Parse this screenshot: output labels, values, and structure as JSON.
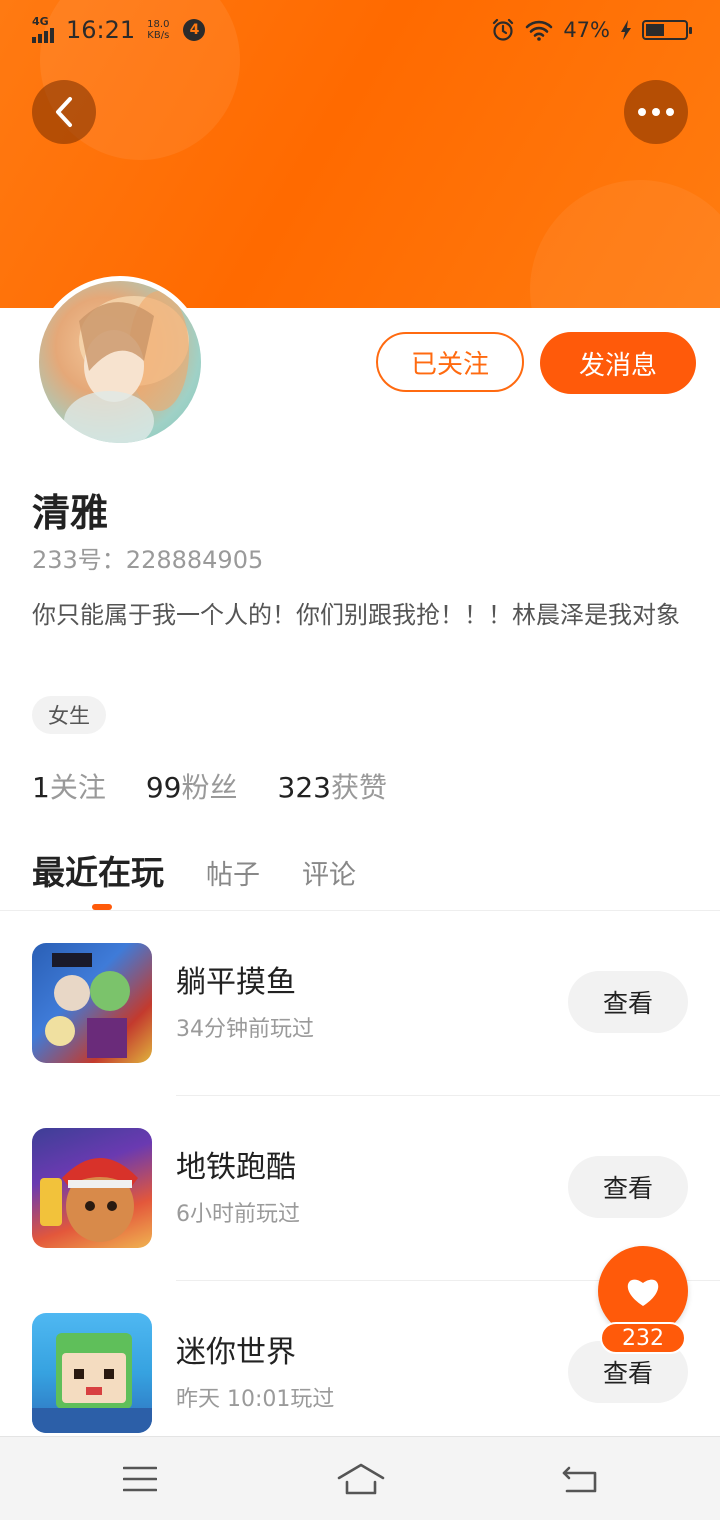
{
  "status_bar": {
    "network": "4G",
    "time": "16:21",
    "speed_value": "18.0",
    "speed_unit": "KB/s",
    "notification_count": "4",
    "battery_percent": "47%"
  },
  "profile": {
    "name": "清雅",
    "id_text": "233号：228884905",
    "bio": "你只能属于我一个人的！你们别跟我抢！！！林晨泽是我对象",
    "gender_tag": "女生"
  },
  "actions": {
    "follow_label": "已关注",
    "message_label": "发消息"
  },
  "stats": [
    {
      "value": "1",
      "label": "关注"
    },
    {
      "value": "99",
      "label": "粉丝"
    },
    {
      "value": "323",
      "label": "获赞"
    }
  ],
  "tabs": [
    "最近在玩",
    "帖子",
    "评论"
  ],
  "games": [
    {
      "title": "躺平摸鱼",
      "time": "34分钟前玩过",
      "button": "查看"
    },
    {
      "title": "地铁跑酷",
      "time": "6小时前玩过",
      "button": "查看"
    },
    {
      "title": "迷你世界",
      "time": "昨天 10:01玩过",
      "button": "查看"
    }
  ],
  "like": {
    "count": "232"
  },
  "colors": {
    "accent": "#ff5a0a",
    "banner": "#ff7a12"
  }
}
